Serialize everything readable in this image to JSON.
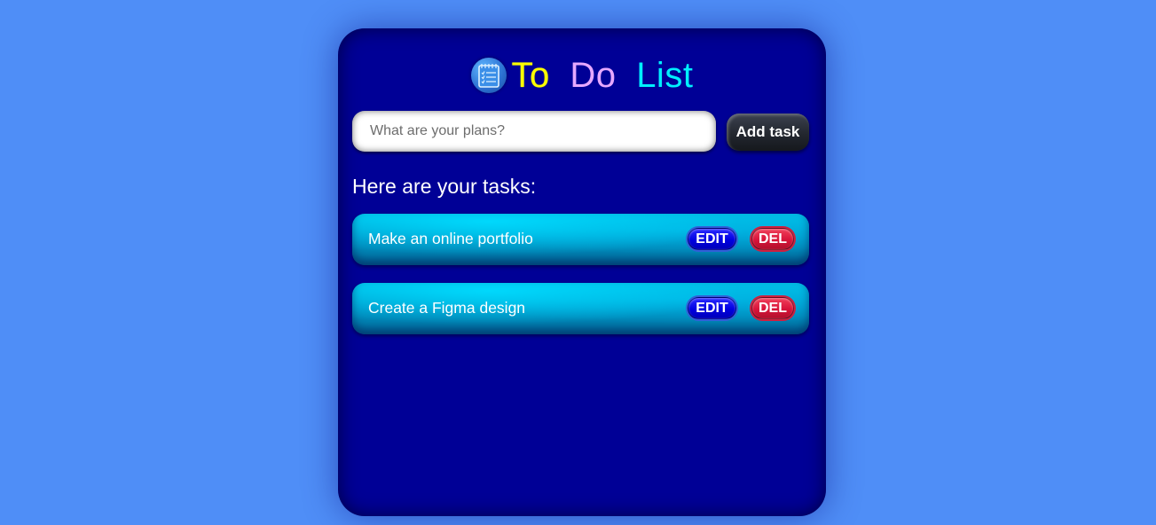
{
  "app": {
    "title_words": [
      "To",
      "Do",
      "List"
    ],
    "title_word_colors": [
      "#ffff00",
      "#e6a8ff",
      "#00f0ff"
    ],
    "icon": "notepad-icon"
  },
  "input": {
    "placeholder": "What are your plans?",
    "value": ""
  },
  "add_button": {
    "label": "Add task"
  },
  "tasks_heading": "Here are your tasks:",
  "tasks": [
    {
      "text": "Make an online portfolio",
      "edit_label": "EDIT",
      "delete_label": "DEL"
    },
    {
      "text": "Create a Figma design",
      "edit_label": "EDIT",
      "delete_label": "DEL"
    }
  ],
  "colors": {
    "background": "#4f8ef7",
    "card": "#000096",
    "task_item": "#00a8d8",
    "edit_button": "#0000e0",
    "delete_button": "#d8143a"
  }
}
